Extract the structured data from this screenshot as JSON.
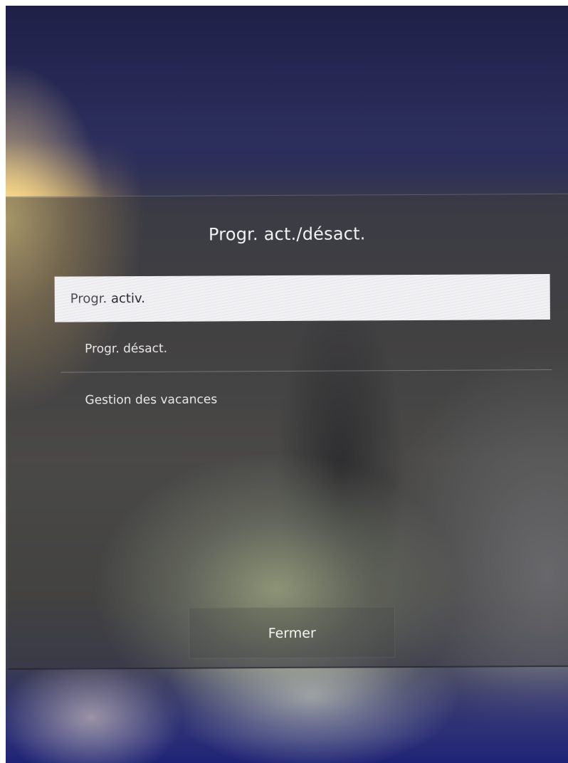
{
  "dialog": {
    "title": "Progr. act./désact."
  },
  "menu": {
    "items": [
      {
        "label_prefix": "Progr. ",
        "label_main": "activ.",
        "selected": true
      },
      {
        "label": "Progr. désact.",
        "selected": false
      },
      {
        "label": "Gestion des vacances",
        "selected": false
      }
    ]
  },
  "footer": {
    "close_label": "Fermer"
  },
  "colors": {
    "highlight": "#f1f1f3",
    "text": "#e8e8ea",
    "background_top": "#2a2b4f"
  }
}
